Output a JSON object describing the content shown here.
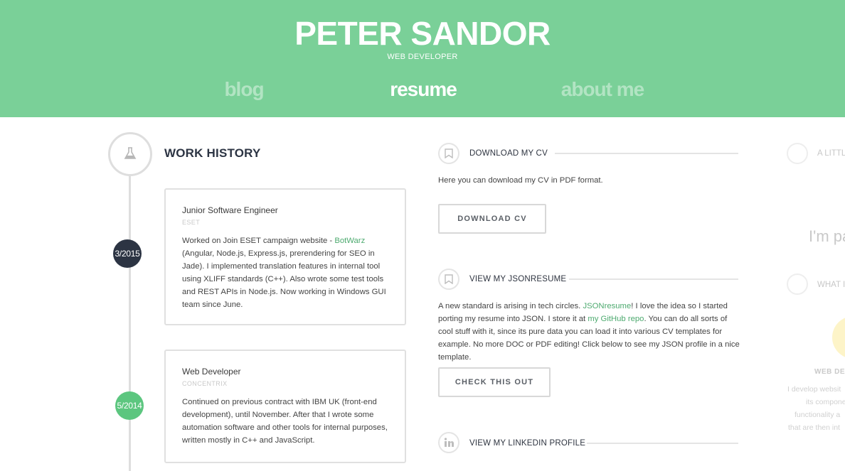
{
  "header": {
    "title": "PETER SANDOR",
    "subtitle": "WEB DEVELOPER",
    "nav": [
      {
        "label": "blog",
        "active": false
      },
      {
        "label": "resume",
        "active": true
      },
      {
        "label": "about me",
        "active": false
      }
    ],
    "color": "#7ad098"
  },
  "work_history": {
    "heading": "WORK HISTORY",
    "icon": "flask-icon",
    "jobs": [
      {
        "date": "3/2015",
        "date_color": "#2c3443",
        "title": "Junior Software Engineer",
        "company": "ESET",
        "desc_before": "Worked on Join ESET campaign website - ",
        "desc_link": "BotWarz",
        "desc_after": " (Angular, Node.js, Express.js, prerendering for SEO in Jade). I implemented translation features in internal tool using XLIFF standards (C++). Also wrote some test tools and REST APIs in Node.js. Now working in Windows GUI team since June."
      },
      {
        "date": "5/2014",
        "date_color": "#5cc67f",
        "title": "Web Developer",
        "company": "CONCENTRIX",
        "desc": "Continued on previous contract with IBM UK (front-end development), until November. After that I wrote some automation software and other tools for internal purposes, written mostly in C++ and JavaScript."
      }
    ]
  },
  "download_cv": {
    "heading": "DOWNLOAD MY CV",
    "icon": "bookmark-icon",
    "text": "Here you can download my CV in PDF format.",
    "button": "DOWNLOAD CV"
  },
  "jsonresume": {
    "heading": "VIEW MY JSONRESUME",
    "icon": "bookmark-icon",
    "text_1": "A new standard is arising in tech circles. ",
    "link_1": "JSONresume",
    "text_2": "! I love the idea so I started porting my resume into JSON. I store it at ",
    "link_2": "my GitHub repo",
    "text_3": ". You can do all sorts of cool stuff with it, since its pure data you can load it into various CV templates for example. No more DOC or PDF editing! Click below to see my JSON profile in a nice template.",
    "button": "CHECK THIS OUT"
  },
  "linkedin": {
    "heading": "VIEW MY LINKEDIN PROFILE",
    "icon": "linkedin-icon"
  },
  "right_column": {
    "heading_1": "A LITTL",
    "big_text_1": "I",
    "big_text_2": "I'm pa",
    "heading_2": "WHAT I",
    "sub_heading": "WEB DE",
    "lines": [
      "I develop websit",
      "its component",
      "functionality a",
      "that are then int"
    ]
  },
  "colors": {
    "accent_green": "#7ad098",
    "link_green": "#4daa6f",
    "dark_navy": "#2c3443"
  }
}
